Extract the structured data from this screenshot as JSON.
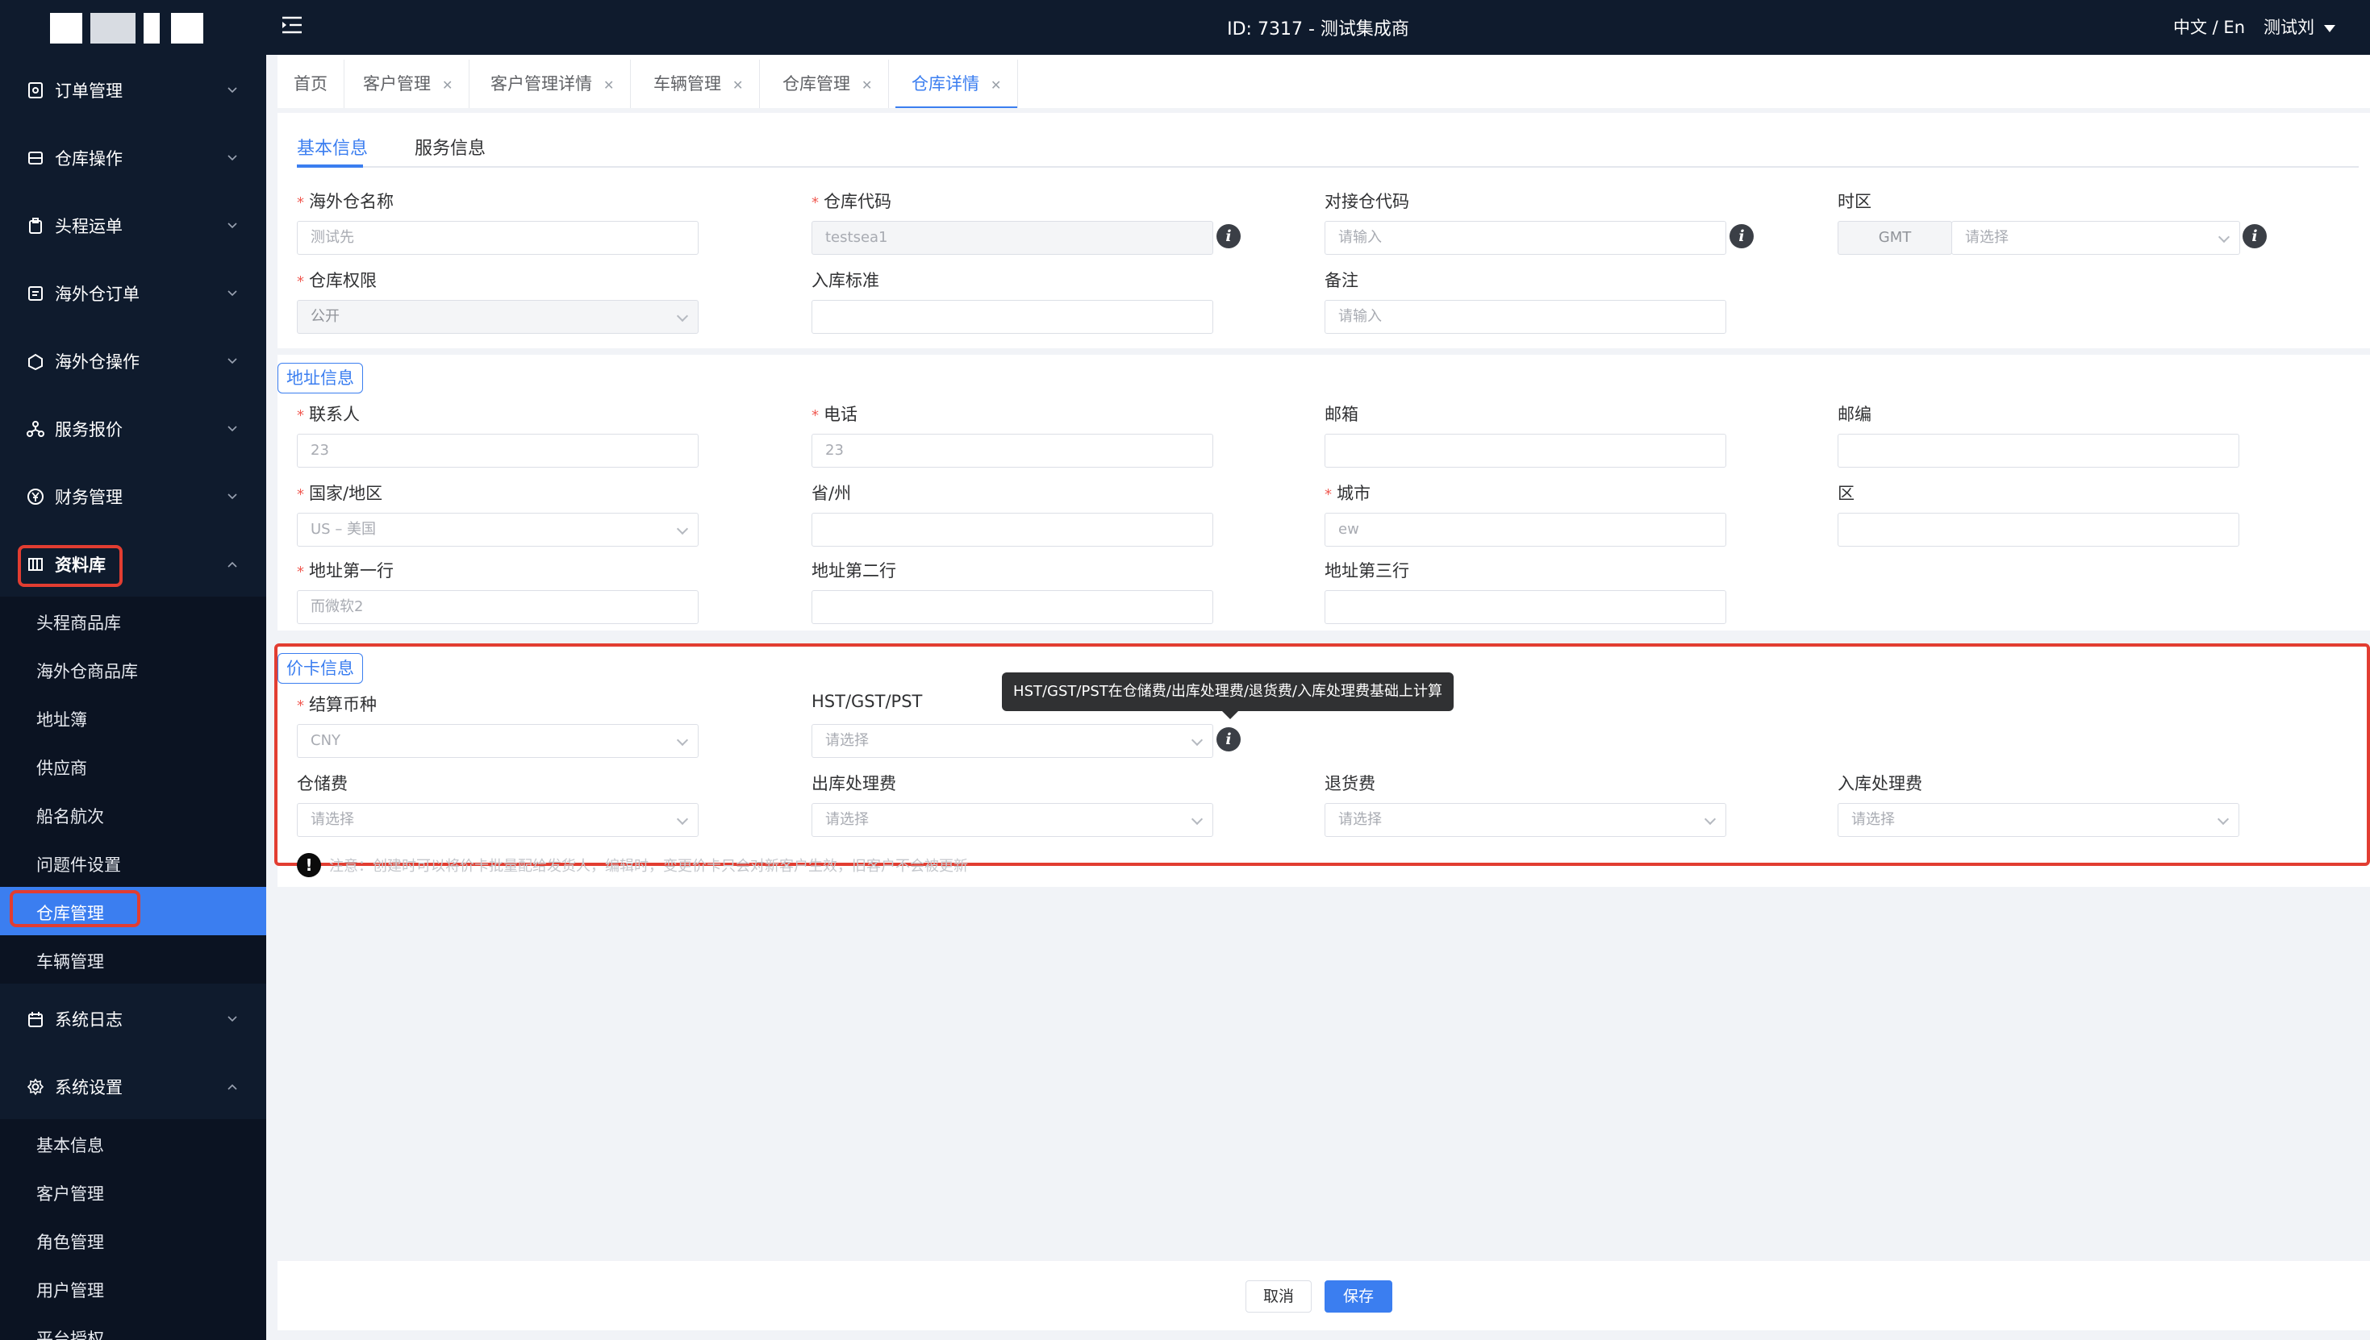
{
  "header": {
    "title": "ID: 7317 - 测试集成商",
    "lang": "中文 / En",
    "user": "测试刘"
  },
  "sidebar": {
    "items": [
      {
        "label": "订单管理"
      },
      {
        "label": "仓库操作"
      },
      {
        "label": "头程运单"
      },
      {
        "label": "海外仓订单"
      },
      {
        "label": "海外仓操作"
      },
      {
        "label": "服务报价"
      },
      {
        "label": "财务管理"
      },
      {
        "label": "资料库"
      },
      {
        "label": "系统日志"
      },
      {
        "label": "系统设置"
      }
    ],
    "library_sub": [
      {
        "label": "头程商品库"
      },
      {
        "label": "海外仓商品库"
      },
      {
        "label": "地址簿"
      },
      {
        "label": "供应商"
      },
      {
        "label": "船名航次"
      },
      {
        "label": "问题件设置"
      },
      {
        "label": "仓库管理"
      },
      {
        "label": "车辆管理"
      }
    ],
    "settings_sub": [
      {
        "label": "基本信息"
      },
      {
        "label": "客户管理"
      },
      {
        "label": "角色管理"
      },
      {
        "label": "用户管理"
      },
      {
        "label": "平台授权"
      }
    ]
  },
  "tabs": [
    {
      "label": "首页"
    },
    {
      "label": "客户管理"
    },
    {
      "label": "客户管理详情"
    },
    {
      "label": "车辆管理"
    },
    {
      "label": "仓库管理"
    },
    {
      "label": "仓库详情"
    }
  ],
  "subtabs": {
    "basic": "基本信息",
    "service": "服务信息"
  },
  "basic": {
    "name": {
      "label": "海外仓名称",
      "value": "测试先"
    },
    "code": {
      "label": "仓库代码",
      "value": "testsea1"
    },
    "dock_code": {
      "label": "对接仓代码",
      "placeholder": "请输入"
    },
    "timezone": {
      "label": "时区",
      "prefix": "GMT",
      "placeholder": "请选择"
    },
    "permission": {
      "label": "仓库权限",
      "value": "公开"
    },
    "standard": {
      "label": "入库标准"
    },
    "remark": {
      "label": "备注",
      "placeholder": "请输入"
    }
  },
  "address": {
    "section": "地址信息",
    "contact": {
      "label": "联系人",
      "value": "23"
    },
    "phone": {
      "label": "电话",
      "value": "23"
    },
    "email": {
      "label": "邮箱"
    },
    "zip": {
      "label": "邮编"
    },
    "country": {
      "label": "国家/地区",
      "value": "US – 美国"
    },
    "province": {
      "label": "省/州"
    },
    "city": {
      "label": "城市",
      "value": "ew"
    },
    "district": {
      "label": "区"
    },
    "line1": {
      "label": "地址第一行",
      "value": "而微软2"
    },
    "line2": {
      "label": "地址第二行"
    },
    "line3": {
      "label": "地址第三行"
    }
  },
  "pricing": {
    "section": "价卡信息",
    "currency": {
      "label": "结算币种",
      "value": "CNY"
    },
    "tax": {
      "label": "HST/GST/PST",
      "placeholder": "请选择"
    },
    "tooltip": "HST/GST/PST在仓储费/出库处理费/退货费/入库处理费基础上计算",
    "storage": {
      "label": "仓储费",
      "placeholder": "请选择"
    },
    "outbound": {
      "label": "出库处理费",
      "placeholder": "请选择"
    },
    "return_fee": {
      "label": "退货费",
      "placeholder": "请选择"
    },
    "inbound": {
      "label": "入库处理费",
      "placeholder": "请选择"
    },
    "note": "注意：创建时可以将价卡批量配给发货人，编辑时，变更价卡只会对新客户生效，旧客户不会被更新"
  },
  "footer": {
    "cancel": "取消",
    "save": "保存"
  },
  "colors": {
    "primary": "#3b7ef0",
    "sidebar": "#0f1b2d",
    "highlight": "#e23d31"
  }
}
